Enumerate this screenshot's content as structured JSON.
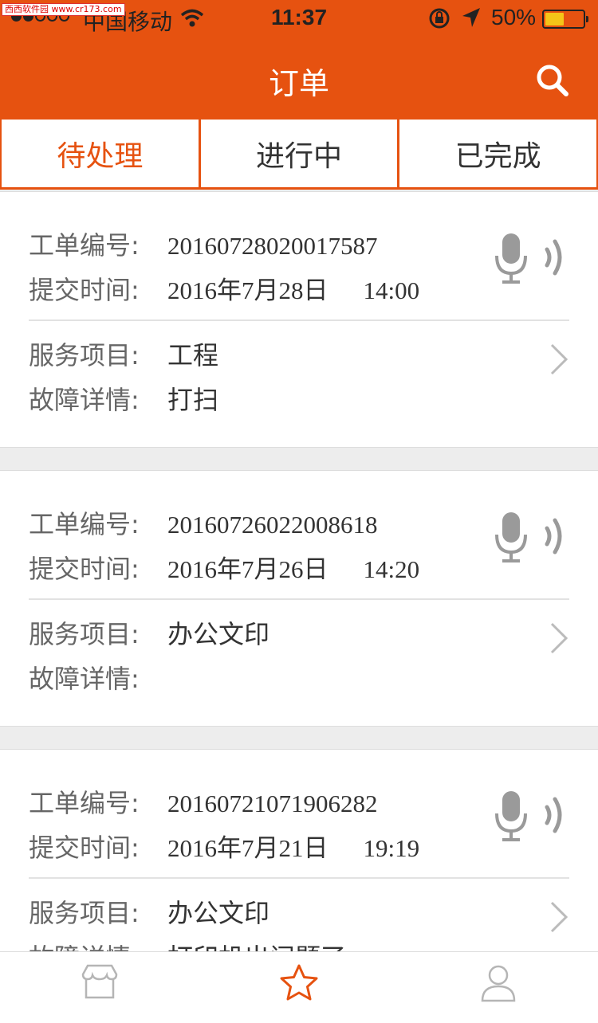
{
  "watermark": "西西软件园 www.cr173.com",
  "status_bar": {
    "carrier": "中国移动",
    "time": "11:37",
    "battery_percent": "50%",
    "battery_level": 0.5,
    "wifi_icon": "wifi-icon",
    "lock_icon": "rotation-lock-icon",
    "location_icon": "location-arrow-icon"
  },
  "nav": {
    "title": "订单",
    "search_icon": "search-icon"
  },
  "tabs": [
    {
      "label": "待处理",
      "active": true
    },
    {
      "label": "进行中",
      "active": false
    },
    {
      "label": "已完成",
      "active": false
    }
  ],
  "labels": {
    "order_no": "工单编号:",
    "submit_time": "提交时间:",
    "service": "服务项目:",
    "fault": "故障详情:"
  },
  "orders": [
    {
      "order_no": "20160728020017587",
      "date": "2016年7月28日",
      "time": "14:00",
      "service": "工程",
      "fault": "打扫"
    },
    {
      "order_no": "20160726022008618",
      "date": "2016年7月26日",
      "time": "14:20",
      "service": "办公文印",
      "fault": ""
    },
    {
      "order_no": "20160721071906282",
      "date": "2016年7月21日",
      "time": "19:19",
      "service": "办公文印",
      "fault": "打印机出问题了"
    }
  ],
  "tabbar": [
    {
      "icon": "shop-icon",
      "active": false
    },
    {
      "icon": "star-icon",
      "active": true
    },
    {
      "icon": "user-icon",
      "active": false
    }
  ],
  "colors": {
    "accent": "#e65210",
    "icon_gray": "#9a9a9a"
  }
}
